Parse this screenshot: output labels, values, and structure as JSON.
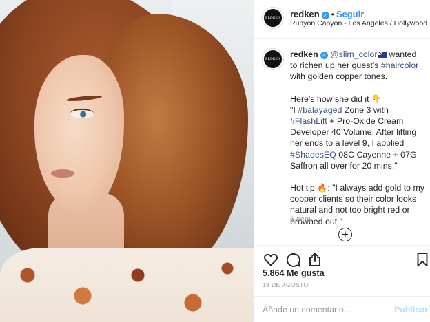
{
  "post": {
    "avatar_text": "REDKEN",
    "username": "redken",
    "verified_mark": "✓",
    "separator": "•",
    "follow_label": "Seguir",
    "location": "Runyon Canyon - Los Angeles / Hollywood"
  },
  "caption": {
    "username": "redken",
    "mention": "@slim_color",
    "text1": "wanted to richen up her guest's",
    "hashtag_haircolor": "#haircolor",
    "text2": "with golden copper tones.",
    "p2_text1": "Here's how she did it",
    "p2_emoji": "👇",
    "p2_text2": "\"I",
    "hashtag_balayaged": "#balayaged",
    "p2_text3": "Zone 3 with",
    "hashtag_flashlift": "#FlashLift",
    "p2_text4": "+ Pro-Oxide Cream Developer 40 Volume. After lifting her ends to a level 9, I applied",
    "hashtag_shadeseq": "#ShadesEQ",
    "p2_text5": "08C Cayenne + 07G Saffron all over for 20 mins.\"",
    "p3_text1": "Hot tip",
    "p3_emoji": "🔥",
    "p3_text2": ": \"I always add gold to my copper clients so their color looks natural and not too bright red or browned out.\"",
    "time_ago": "6 sem",
    "load_more_symbol": "+"
  },
  "icons": {
    "like": "heart-icon",
    "comment": "comment-icon",
    "share": "share-icon",
    "save": "bookmark-icon",
    "load_more": "plus-circle-icon"
  },
  "stats": {
    "likes": "5.864 Me gusta",
    "date": "18 DE AGOSTO"
  },
  "comment": {
    "placeholder": "Añade un comentario...",
    "post_label": "Publicar"
  },
  "colors": {
    "link_blue": "#3897f0",
    "hashtag": "#385185",
    "post_disabled": "#b2dffc"
  }
}
